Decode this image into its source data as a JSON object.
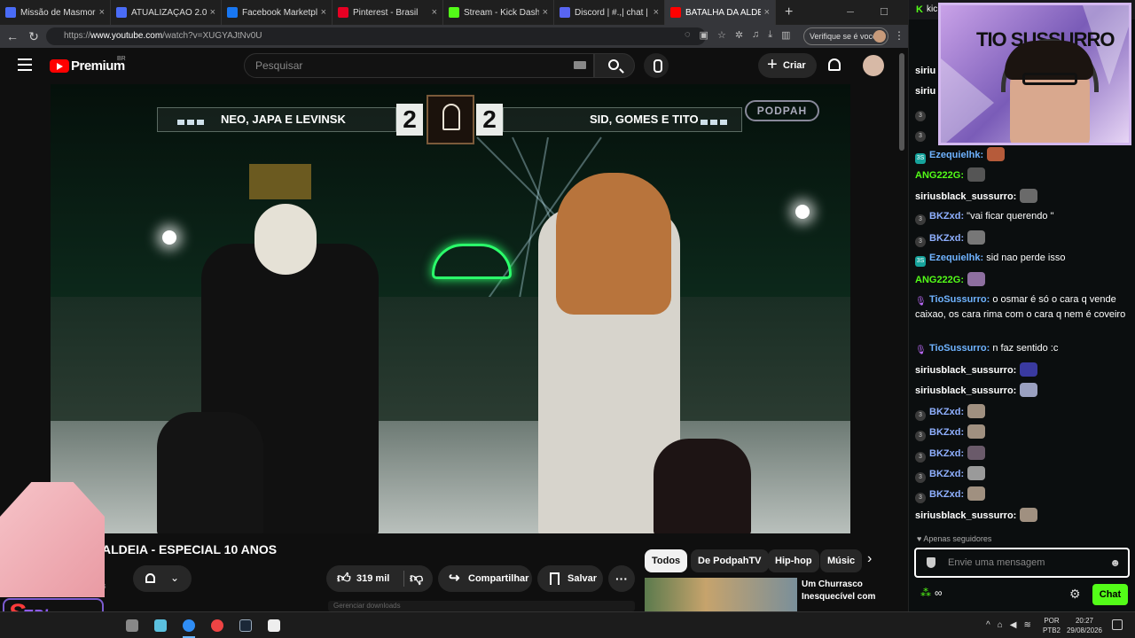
{
  "browser": {
    "tabs": [
      {
        "label": "Missão de Masmorras R",
        "color": "#4a6cf7",
        "active": false
      },
      {
        "label": "ATUALIZAÇÃO 2.0 [VERÃ",
        "color": "#4a6cf7",
        "active": false
      },
      {
        "label": "Facebook Marketplace |",
        "color": "#1877f2",
        "active": false
      },
      {
        "label": "Pinterest - Brasil",
        "color": "#e60023",
        "active": false
      },
      {
        "label": "Stream - Kick Dashb",
        "color": "#53fc18",
        "active": false
      },
      {
        "label": "Discord | #.,| chat | :",
        "color": "#5865f2",
        "active": false
      },
      {
        "label": "BATALHA DA ALDE",
        "color": "#ff0000",
        "active": true
      }
    ],
    "url_prefix": "https://",
    "url_host": "www.youtube.com",
    "url_path": "/watch?v=XUGYAJtNv0U",
    "verify_label": "Verifique se é você"
  },
  "youtube": {
    "brand": "Premium",
    "region": "BR",
    "search_placeholder": "Pesquisar",
    "create_label": "Criar",
    "video": {
      "team_left": "NEO, JAPA E LEVINSK",
      "team_right": "SID, GOMES E TITO",
      "score_left": "2",
      "score_right": "2",
      "watermark": "PODPAH"
    },
    "title_visible": "ALDEIA - ESPECIAL 10 ANOS",
    "channel_sub_fragment": "os",
    "likes": "319 mil",
    "share_label": "Compartilhar",
    "save_label": "Salvar",
    "chips": [
      "Todos",
      "De PodpahTV",
      "Hip-hop",
      "Músic"
    ],
    "rec_title": "Um Churrasco Inesquecível com",
    "downloads_label": "Gerenciar downloads"
  },
  "overlay": {
    "sephone_label": "EPhone",
    "sephone_s": "S"
  },
  "chat": {
    "header": "kic",
    "webcam_label": "TIO SUSSURRO",
    "messages": [
      {
        "badge": "",
        "user": "siriu",
        "user_color": "#ffffff",
        "text": "",
        "emote": false
      },
      {
        "badge": "",
        "user": "siriu",
        "user_color": "#ffffff",
        "text": "",
        "emote": false
      },
      {
        "badge": "3",
        "user": "",
        "user_color": "#ffffff",
        "text": "",
        "emote": false
      },
      {
        "badge": "3",
        "user": "",
        "user_color": "#ffffff",
        "text": "",
        "emote": false
      },
      {
        "badge": "3S",
        "user": "Ezequielhk:",
        "user_color": "#6fb3ff",
        "text": "",
        "emote": true
      },
      {
        "badge": "",
        "user": "ANG222G:",
        "user_color": "#53fc18",
        "text": "",
        "emote": true
      },
      {
        "badge": "",
        "user": "siriusblack_sussurro:",
        "user_color": "#ffffff",
        "text": "",
        "emote": true
      },
      {
        "badge": "3",
        "user": "BKZxd:",
        "user_color": "#8fb0ff",
        "text": "\"vai ficar querendo \"",
        "emote": false
      },
      {
        "badge": "3",
        "user": "BKZxd:",
        "user_color": "#8fb0ff",
        "text": "",
        "emote": true
      },
      {
        "badge": "3S",
        "user": "Ezequielhk:",
        "user_color": "#6fb3ff",
        "text": "sid nao perde isso",
        "emote": false
      },
      {
        "badge": "",
        "user": "ANG222G:",
        "user_color": "#53fc18",
        "text": "",
        "emote": true
      },
      {
        "badge": "mic",
        "user": "TioSussurro:",
        "user_color": "#6fb3ff",
        "text": "o osmar é só o cara q vende caixao, os cara rima com o cara q nem é coveiro",
        "emote": false
      },
      {
        "badge": "mic",
        "user": "TioSussurro:",
        "user_color": "#6fb3ff",
        "text": "n faz sentido :c",
        "emote": false
      },
      {
        "badge": "",
        "user": "siriusblack_sussurro:",
        "user_color": "#ffffff",
        "text": "",
        "emote": true
      },
      {
        "badge": "",
        "user": "siriusblack_sussurro:",
        "user_color": "#ffffff",
        "text": "",
        "emote": true
      },
      {
        "badge": "3",
        "user": "BKZxd:",
        "user_color": "#8fb0ff",
        "text": "",
        "emote": true
      },
      {
        "badge": "3",
        "user": "BKZxd:",
        "user_color": "#8fb0ff",
        "text": "",
        "emote": true
      },
      {
        "badge": "3",
        "user": "BKZxd:",
        "user_color": "#8fb0ff",
        "text": "",
        "emote": true
      },
      {
        "badge": "3",
        "user": "BKZxd:",
        "user_color": "#8fb0ff",
        "text": "",
        "emote": true
      },
      {
        "badge": "3",
        "user": "BKZxd:",
        "user_color": "#8fb0ff",
        "text": "",
        "emote": true
      },
      {
        "badge": "",
        "user": "siriusblack_sussurro:",
        "user_color": "#ffffff",
        "text": "",
        "emote": true
      }
    ],
    "followers_only": "Apenas seguidores",
    "input_placeholder": "Envie uma mensagem",
    "chat_button": "Chat"
  },
  "taskbar": {
    "lang_top": "POR",
    "lang_bottom": "PTB2",
    "time": "20:27",
    "date": "29/08/2026"
  }
}
